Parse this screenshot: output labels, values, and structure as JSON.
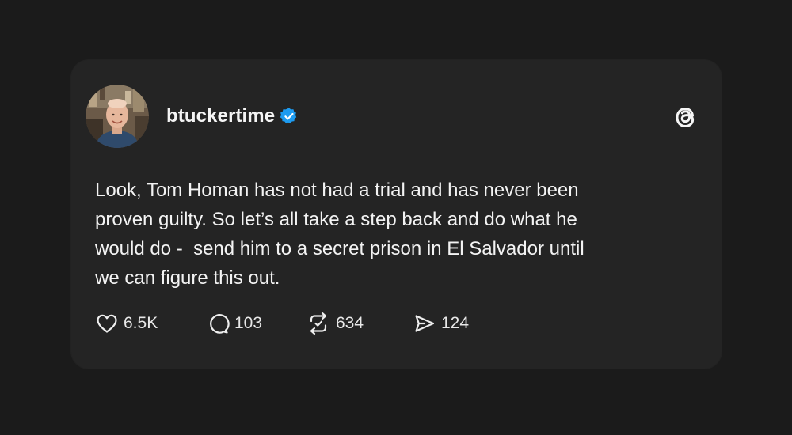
{
  "post": {
    "username": "btuckertime",
    "text_lines": [
      "Look, Tom Homan has not had a trial and has never been",
      "proven guilty. So let’s all take a step back and do what he",
      "would do -  send him to a secret prison in El Salvador until",
      "we can figure this out."
    ]
  },
  "stats": {
    "likes": "6.5K",
    "replies": "103",
    "reposts": "634",
    "shares": "124"
  },
  "icons": {
    "avatar": "avatar",
    "verified": "verified-badge-icon",
    "brand": "threads-logo-icon",
    "like": "heart-icon",
    "reply": "comment-bubble-icon",
    "repost": "repost-icon",
    "share": "send-icon"
  },
  "colors": {
    "background": "#1b1b1b",
    "card": "#242424",
    "text": "#f3f3f3",
    "verified": "#1d9bf0"
  }
}
